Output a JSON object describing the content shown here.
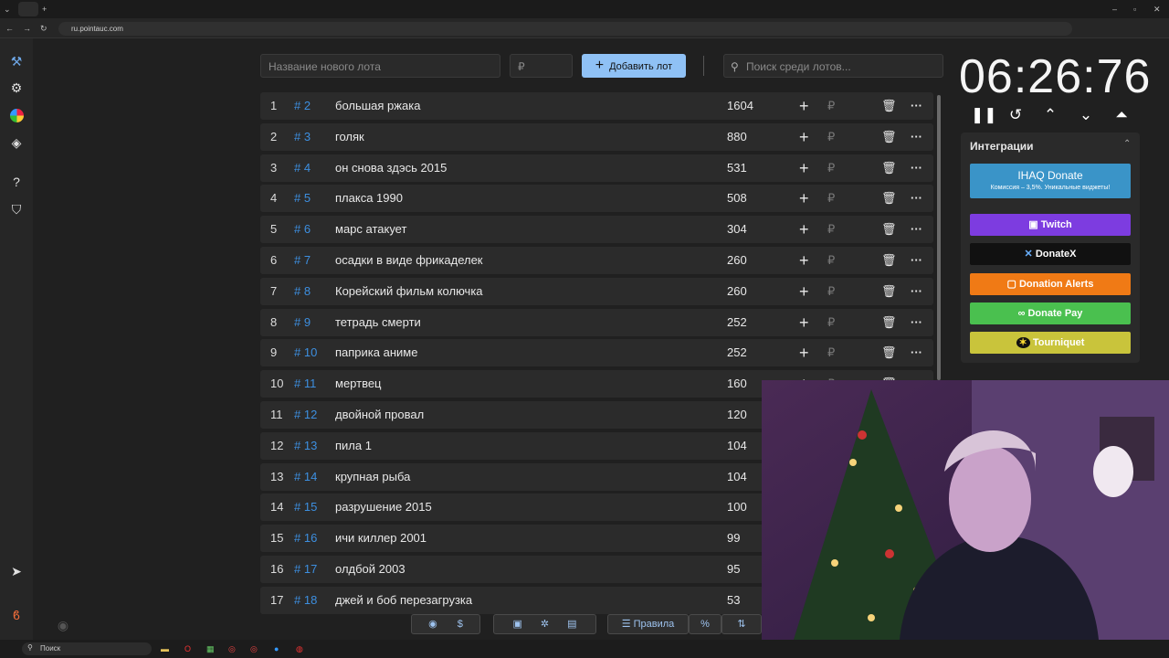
{
  "browser": {
    "url": "ru.pointauc.com"
  },
  "top": {
    "lot_placeholder": "Название нового лота",
    "amount_placeholder": "₽",
    "add_label": "Добавить лот",
    "search_placeholder": "Поиск среди лотов..."
  },
  "lots": [
    {
      "idx": "1",
      "id": "# 2",
      "name": "большая ржака",
      "amount": "1604"
    },
    {
      "idx": "2",
      "id": "# 3",
      "name": "голяк",
      "amount": "880"
    },
    {
      "idx": "3",
      "id": "# 4",
      "name": "он снова здэсь 2015",
      "amount": "531"
    },
    {
      "idx": "4",
      "id": "# 5",
      "name": "плакса 1990",
      "amount": "508"
    },
    {
      "idx": "5",
      "id": "# 6",
      "name": "марс атакует",
      "amount": "304"
    },
    {
      "idx": "6",
      "id": "# 7",
      "name": "осадки в виде фрикаделек",
      "amount": "260"
    },
    {
      "idx": "7",
      "id": "# 8",
      "name": "Корейский фильм колючка",
      "amount": "260"
    },
    {
      "idx": "8",
      "id": "# 9",
      "name": "тетрадь смерти",
      "amount": "252"
    },
    {
      "idx": "9",
      "id": "# 10",
      "name": "паприка аниме",
      "amount": "252"
    },
    {
      "idx": "10",
      "id": "# 11",
      "name": "мертвец",
      "amount": "160"
    },
    {
      "idx": "11",
      "id": "# 12",
      "name": " двойной провал",
      "amount": "120"
    },
    {
      "idx": "12",
      "id": "# 13",
      "name": "пила 1",
      "amount": "104"
    },
    {
      "idx": "13",
      "id": "# 14",
      "name": "крупная рыба",
      "amount": "104"
    },
    {
      "idx": "14",
      "id": "# 15",
      "name": "разрушение 2015",
      "amount": "100"
    },
    {
      "idx": "15",
      "id": "# 16",
      "name": "ичи киллер 2001",
      "amount": "99"
    },
    {
      "idx": "16",
      "id": "# 17",
      "name": "олдбой 2003",
      "amount": "95"
    },
    {
      "idx": "17",
      "id": "# 18",
      "name": "джей и боб перезагрузка",
      "amount": "53"
    }
  ],
  "timer": {
    "value": "06:26:76"
  },
  "integrations": {
    "title": "Интеграции",
    "ihaq": {
      "label": "IHAQ Donate",
      "sub": "Комиссия – 3,5%. Уникальные виджеты!"
    },
    "twitch": "Twitch",
    "donatex": "DonateX",
    "donation_alerts": "Donation Alerts",
    "donate_pay": "Donate Pay",
    "tourniquet": "Tourniquet"
  },
  "toolbar": {
    "rules": "Правила"
  },
  "taskbar": {
    "search": "Поиск"
  },
  "colors": {
    "accent": "#8fc1f5",
    "id_link": "#3d8fe0",
    "twitch": "#7d3ce0",
    "alerts": "#f07a15",
    "pay": "#4ac04f",
    "tourniquet": "#c9c43b",
    "ihaq": "#3a94c8"
  }
}
